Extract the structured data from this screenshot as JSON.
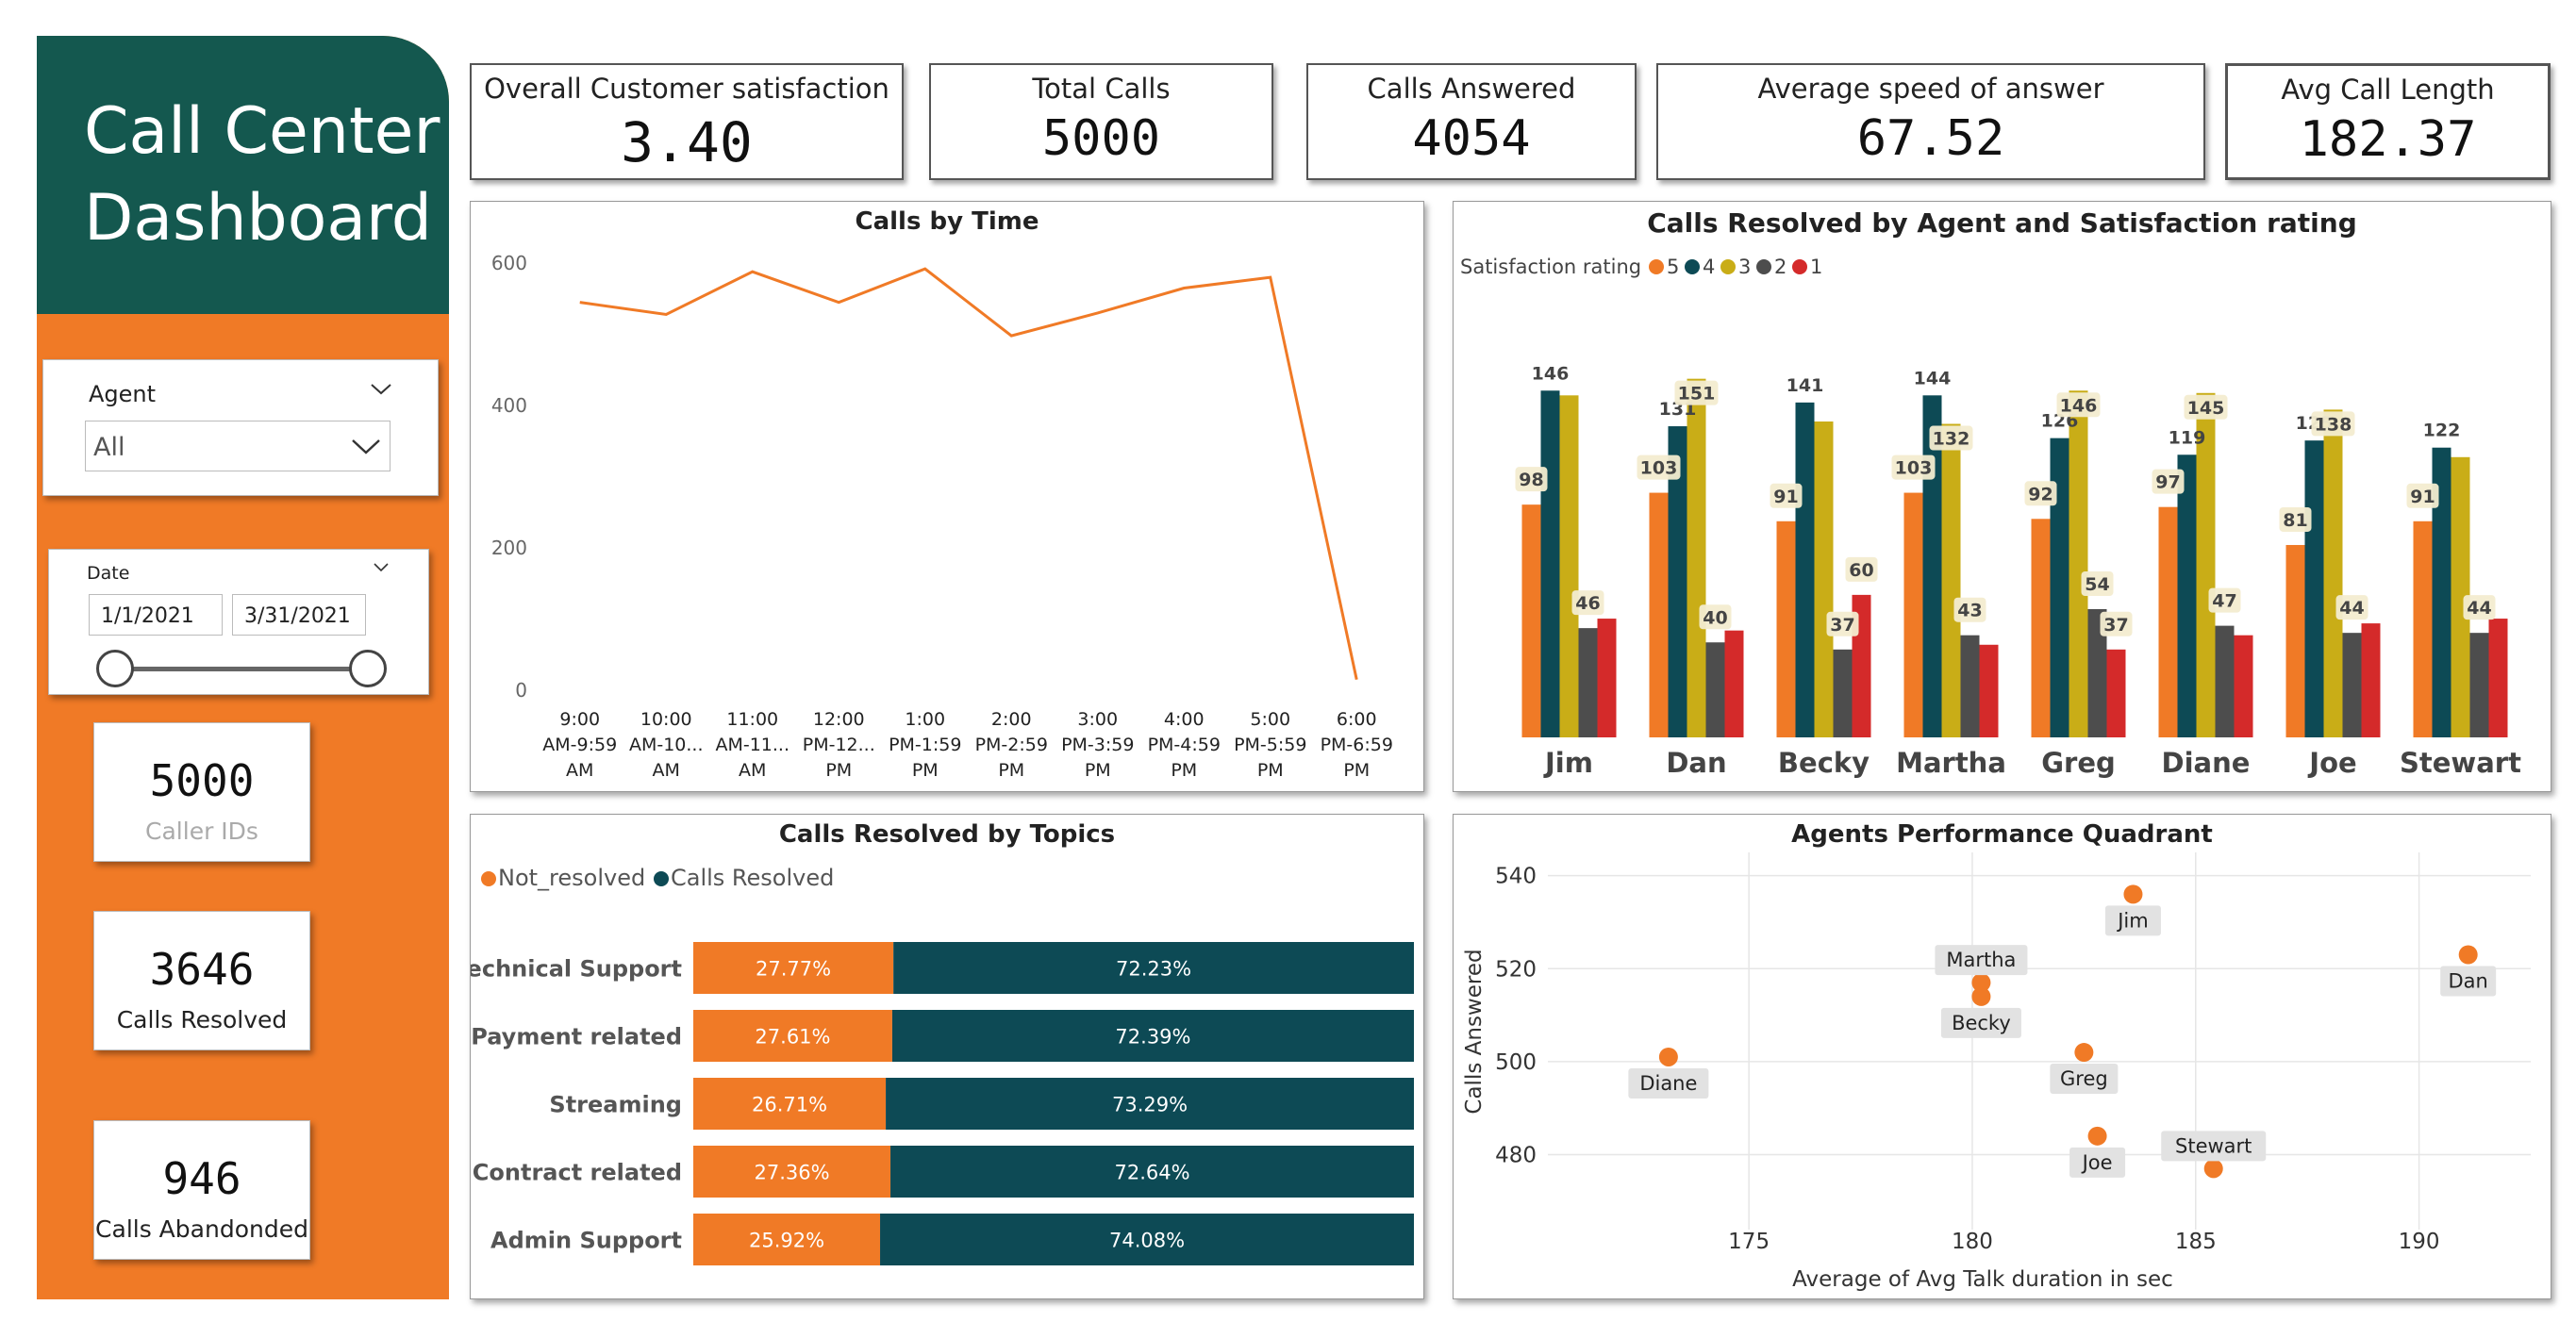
{
  "dashboard": {
    "title": "Call Center\nDashboard"
  },
  "slicers": {
    "agent": {
      "label": "Agent",
      "value": "All"
    },
    "date": {
      "label": "Date",
      "start": "1/1/2021",
      "end": "3/31/2021"
    }
  },
  "side_cards": [
    {
      "value": "5000",
      "label": "Caller IDs"
    },
    {
      "value": "3646",
      "label": "Calls Resolved"
    },
    {
      "value": "946",
      "label": "Calls Abandonded"
    }
  ],
  "kpis": [
    {
      "label": "Overall Customer satisfaction",
      "value": "3.40"
    },
    {
      "label": "Total Calls",
      "value": "5000"
    },
    {
      "label": "Calls Answered",
      "value": "4054"
    },
    {
      "label": "Average speed of answer",
      "value": "67.52"
    },
    {
      "label": "Avg Call Length",
      "value": "182.37"
    }
  ],
  "colors": {
    "sidebar": "#f07a26",
    "title_bg": "#14584f",
    "orange": "#f07a26",
    "teal": "#0d4a55",
    "gold": "#c9ad17",
    "gray": "#4d4d4d",
    "red": "#d42a2a"
  },
  "chart_data": [
    {
      "type": "line",
      "title": "Calls by Time",
      "x": [
        "9:00 AM-9:59 AM",
        "10:00 AM-10... AM",
        "11:00 AM-11... AM",
        "12:00 PM-12... PM",
        "1:00 PM-1:59 PM",
        "2:00 PM-2:59 PM",
        "3:00 PM-3:59 PM",
        "4:00 PM-4:59 PM",
        "5:00 PM-5:59 PM",
        "6:00 PM-6:59 PM"
      ],
      "x_tick_lines": [
        [
          "9:00",
          "AM-9:59",
          "AM"
        ],
        [
          "10:00",
          "AM-10...",
          "AM"
        ],
        [
          "11:00",
          "AM-11...",
          "AM"
        ],
        [
          "12:00",
          "PM-12...",
          "PM"
        ],
        [
          "1:00",
          "PM-1:59",
          "PM"
        ],
        [
          "2:00",
          "PM-2:59",
          "PM"
        ],
        [
          "3:00",
          "PM-3:59",
          "PM"
        ],
        [
          "4:00",
          "PM-4:59",
          "PM"
        ],
        [
          "5:00",
          "PM-5:59",
          "PM"
        ],
        [
          "6:00",
          "PM-6:59",
          "PM"
        ]
      ],
      "values": [
        545,
        528,
        588,
        545,
        592,
        498,
        530,
        565,
        580,
        15
      ],
      "ylim": [
        0,
        620
      ],
      "yticks": [
        0,
        200,
        400,
        600
      ],
      "grid": false
    },
    {
      "type": "bar",
      "title": "Calls Resolved by Agent and Satisfaction rating",
      "legend_title": "Satisfaction rating",
      "categories": [
        "Jim",
        "Dan",
        "Becky",
        "Martha",
        "Greg",
        "Diane",
        "Joe",
        "Stewart"
      ],
      "series": [
        {
          "name": "5",
          "values": [
            98,
            103,
            91,
            103,
            92,
            97,
            81,
            91
          ]
        },
        {
          "name": "4",
          "values": [
            146,
            131,
            141,
            144,
            126,
            119,
            125,
            122
          ]
        },
        {
          "name": "3",
          "values": [
            144,
            151,
            133,
            132,
            146,
            145,
            138,
            118
          ]
        },
        {
          "name": "2",
          "values": [
            46,
            40,
            37,
            43,
            54,
            47,
            44,
            44
          ]
        },
        {
          "name": "1",
          "values": [
            50,
            45,
            60,
            39,
            37,
            43,
            48,
            50
          ]
        }
      ],
      "labels": [
        [
          "98",
          "146",
          "",
          "46",
          ""
        ],
        [
          "103",
          "131",
          "151",
          "40",
          ""
        ],
        [
          "91",
          "141",
          "",
          "37",
          "60"
        ],
        [
          "103",
          "144",
          "132",
          "43",
          ""
        ],
        [
          "92",
          "126",
          "146",
          "54",
          "37"
        ],
        [
          "97",
          "119",
          "145",
          "47",
          ""
        ],
        [
          "81",
          "125",
          "138",
          "44",
          ""
        ],
        [
          "91",
          "122",
          "",
          "44",
          ""
        ]
      ],
      "ylim": [
        0,
        160
      ]
    },
    {
      "type": "bar",
      "orientation": "horizontal-stacked-100",
      "title": "Calls Resolved by Topics",
      "categories": [
        "Technical Support",
        "Payment related",
        "Streaming",
        "Contract related",
        "Admin Support"
      ],
      "series": [
        {
          "name": "Not_resolved",
          "values": [
            27.77,
            27.61,
            26.71,
            27.36,
            25.92
          ],
          "labels": [
            "27.77%",
            "27.61%",
            "26.71%",
            "27.36%",
            "25.92%"
          ]
        },
        {
          "name": "Calls Resolved",
          "values": [
            72.23,
            72.39,
            73.29,
            72.64,
            74.08
          ],
          "labels": [
            "72.23%",
            "72.39%",
            "73.29%",
            "72.64%",
            "74.08%"
          ]
        }
      ]
    },
    {
      "type": "scatter",
      "title": "Agents Performance Quadrant",
      "xlabel": "Average of Avg Talk duration in sec",
      "ylabel": "Calls Answered",
      "xlim": [
        170.5,
        192.5
      ],
      "ylim": [
        472,
        545
      ],
      "xticks": [
        175,
        180,
        185,
        190
      ],
      "yticks": [
        480,
        500,
        520,
        540
      ],
      "grid": true,
      "points": [
        {
          "name": "Jim",
          "x": 183.6,
          "y": 536,
          "label_pos": "below"
        },
        {
          "name": "Dan",
          "x": 191.1,
          "y": 523,
          "label_pos": "below"
        },
        {
          "name": "Martha",
          "x": 180.2,
          "y": 517,
          "label_pos": "above"
        },
        {
          "name": "Becky",
          "x": 180.2,
          "y": 514,
          "label_pos": "below"
        },
        {
          "name": "Diane",
          "x": 173.2,
          "y": 501,
          "label_pos": "below"
        },
        {
          "name": "Greg",
          "x": 182.5,
          "y": 502,
          "label_pos": "below"
        },
        {
          "name": "Joe",
          "x": 182.8,
          "y": 484,
          "label_pos": "below"
        },
        {
          "name": "Stewart",
          "x": 185.4,
          "y": 477,
          "label_pos": "above"
        }
      ]
    }
  ]
}
